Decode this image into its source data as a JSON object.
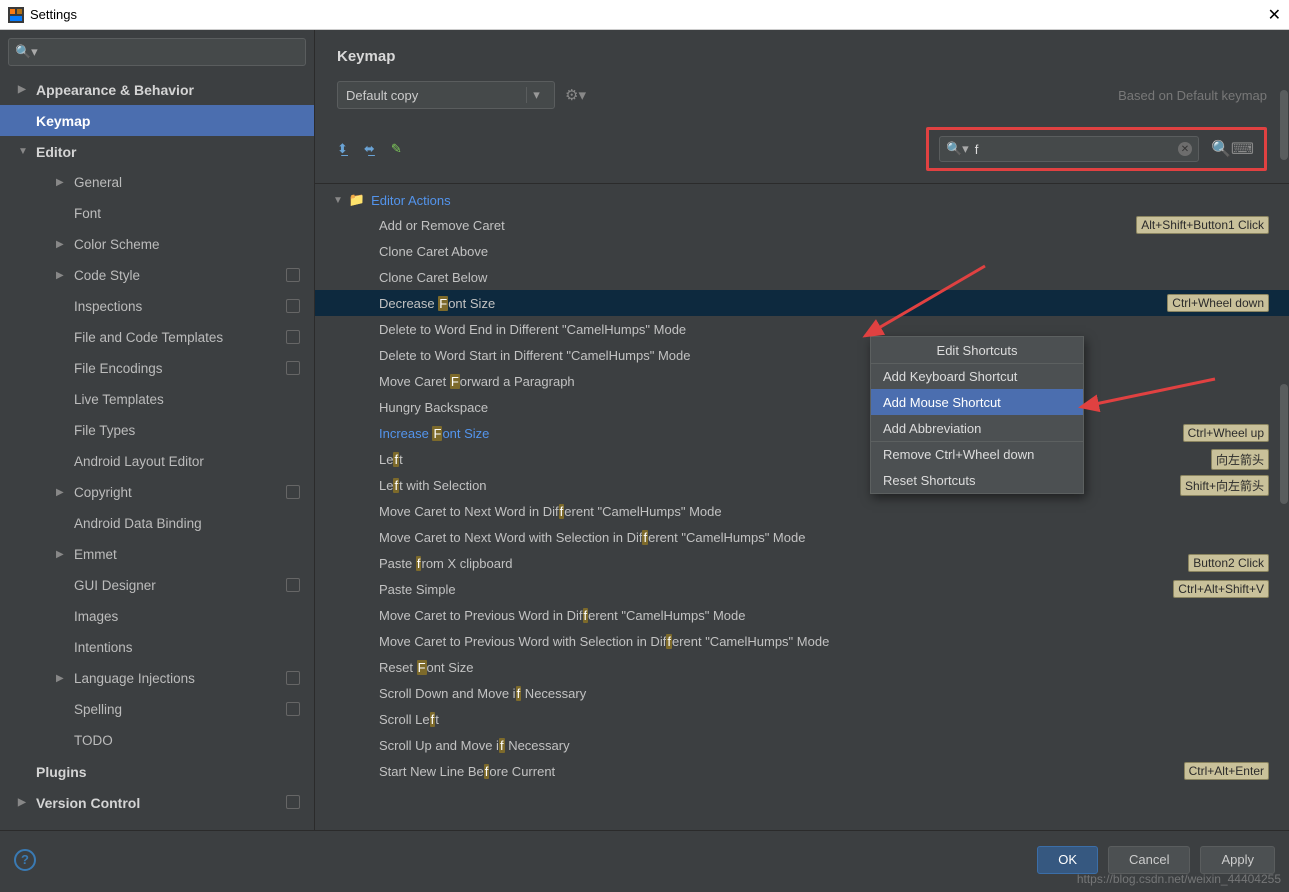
{
  "window": {
    "title": "Settings"
  },
  "sidebar": {
    "items": [
      {
        "label": "Appearance & Behavior",
        "level": 1,
        "caret": "closed"
      },
      {
        "label": "Keymap",
        "level": 1,
        "caret": "",
        "sel": true
      },
      {
        "label": "Editor",
        "level": 1,
        "caret": "open"
      },
      {
        "label": "General",
        "level": 2,
        "caret": "closed"
      },
      {
        "label": "Font",
        "level": 2
      },
      {
        "label": "Color Scheme",
        "level": 2,
        "caret": "closed"
      },
      {
        "label": "Code Style",
        "level": 2,
        "caret": "closed",
        "badge": true
      },
      {
        "label": "Inspections",
        "level": 2,
        "badge": true
      },
      {
        "label": "File and Code Templates",
        "level": 2,
        "badge": true
      },
      {
        "label": "File Encodings",
        "level": 2,
        "badge": true
      },
      {
        "label": "Live Templates",
        "level": 2
      },
      {
        "label": "File Types",
        "level": 2
      },
      {
        "label": "Android Layout Editor",
        "level": 2
      },
      {
        "label": "Copyright",
        "level": 2,
        "caret": "closed",
        "badge": true
      },
      {
        "label": "Android Data Binding",
        "level": 2
      },
      {
        "label": "Emmet",
        "level": 2,
        "caret": "closed"
      },
      {
        "label": "GUI Designer",
        "level": 2,
        "badge": true
      },
      {
        "label": "Images",
        "level": 2
      },
      {
        "label": "Intentions",
        "level": 2
      },
      {
        "label": "Language Injections",
        "level": 2,
        "caret": "closed",
        "badge": true
      },
      {
        "label": "Spelling",
        "level": 2,
        "badge": true
      },
      {
        "label": "TODO",
        "level": 2
      },
      {
        "label": "Plugins",
        "level": 1
      },
      {
        "label": "Version Control",
        "level": 1,
        "caret": "closed",
        "badge": true
      }
    ]
  },
  "keymap": {
    "title": "Keymap",
    "scheme": "Default copy",
    "based_on": "Based on Default keymap",
    "search_query": "f",
    "group": "Editor Actions",
    "actions": [
      {
        "name": "Add or Remove Caret",
        "shortcut": "Alt+Shift+Button1 Click"
      },
      {
        "name": "Clone Caret Above"
      },
      {
        "name": "Clone Caret Below"
      },
      {
        "name": "Decrease Font Size",
        "shortcut": "Ctrl+Wheel down",
        "sel": true,
        "hl": 9
      },
      {
        "name": "Delete to Word End in Different \"CamelHumps\" Mode",
        "trunc": true
      },
      {
        "name": "Delete to Word Start in Different \"CamelHumps\" Mode",
        "trunc": true
      },
      {
        "name": "Move Caret Forward a Paragraph",
        "hl": 11
      },
      {
        "name": "Hungry Backspace"
      },
      {
        "name": "Increase Font Size",
        "shortcut": "Ctrl+Wheel up",
        "hi": true,
        "hl": 9
      },
      {
        "name": "Left",
        "shortcut": "向左箭头",
        "hl": 2
      },
      {
        "name": "Left with Selection",
        "shortcut": "Shift+向左箭头",
        "hl": 2
      },
      {
        "name": "Move Caret to Next Word in Different \"CamelHumps\" Mode",
        "hl": 30
      },
      {
        "name": "Move Caret to Next Word with Selection in Different \"CamelHumps\" Mode",
        "hl": 45
      },
      {
        "name": "Paste from X clipboard",
        "shortcut": "Button2 Click",
        "hl": 6
      },
      {
        "name": "Paste Simple",
        "shortcut": "Ctrl+Alt+Shift+V"
      },
      {
        "name": "Move Caret to Previous Word in Different \"CamelHumps\" Mode",
        "hl": 34
      },
      {
        "name": "Move Caret to Previous Word with Selection in Different \"CamelHumps\" Mode",
        "hl": 49
      },
      {
        "name": "Reset Font Size",
        "hl": 6
      },
      {
        "name": "Scroll Down and Move if Necessary",
        "hl": 22
      },
      {
        "name": "Scroll Left",
        "hl": 9
      },
      {
        "name": "Scroll Up and Move if Necessary",
        "hl": 20
      },
      {
        "name": "Start New Line Before Current",
        "shortcut": "Ctrl+Alt+Enter",
        "hl": 17
      }
    ]
  },
  "context_menu": {
    "items": [
      {
        "label": "Edit Shortcuts",
        "center": true
      },
      {
        "label": "Add Keyboard Shortcut",
        "sep": true
      },
      {
        "label": "Add Mouse Shortcut",
        "sel": true
      },
      {
        "label": "Add Abbreviation"
      },
      {
        "label": "Remove Ctrl+Wheel down",
        "sep": true
      },
      {
        "label": "Reset Shortcuts"
      }
    ]
  },
  "buttons": {
    "ok": "OK",
    "cancel": "Cancel",
    "apply": "Apply"
  },
  "watermark": "https://blog.csdn.net/weixin_44404255"
}
